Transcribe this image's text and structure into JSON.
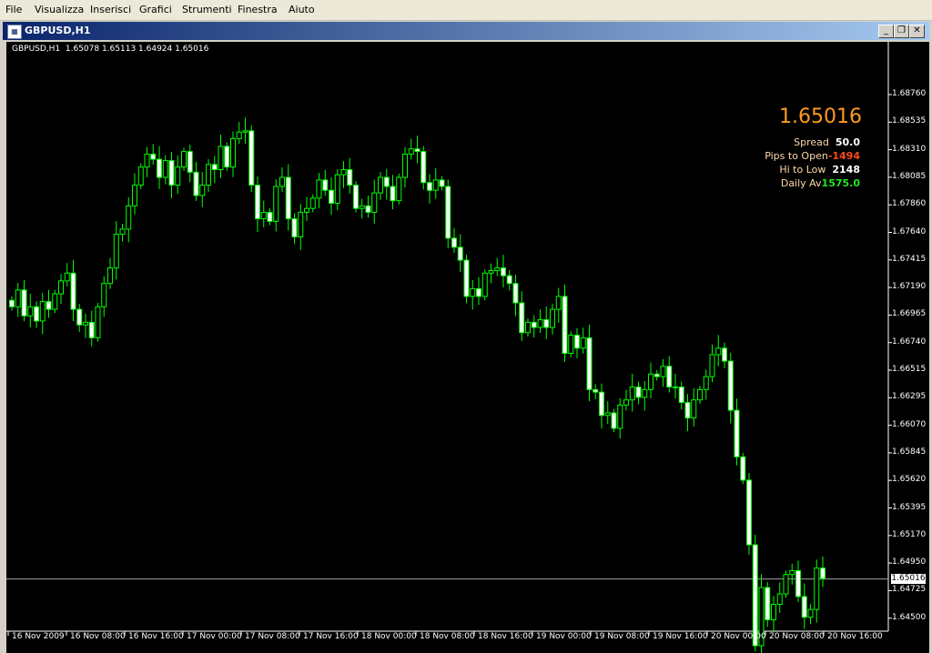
{
  "menu": [
    "File",
    "Visualizza",
    "Inserisci",
    "Grafici",
    "Strumenti",
    "Finestra",
    "Aiuto"
  ],
  "window": {
    "title": "GBPUSD,H1",
    "icon": "chart-window-icon",
    "buttons": [
      "minimize",
      "restore",
      "close"
    ]
  },
  "header": {
    "ohlc": "GBPUSD,H1  1.65078 1.65113 1.64924 1.65016"
  },
  "info_panel": {
    "price": "1.65016",
    "spread_label": "Spread",
    "spread_value": "50.0",
    "pips_label": "Pips to Open",
    "pips_value": "-1494",
    "hilo_label": "Hi to Low",
    "hilo_value": "2148",
    "daily_label": "Daily Av",
    "daily_value": "1575.0",
    "colors": {
      "price": "#ff9a1f",
      "label": "#ffd8a8",
      "spread": "#ffffff",
      "pips": "#ff4a1f",
      "hilo": "#ffffff",
      "daily": "#1fe81f"
    }
  },
  "current_price_tag": "1.65016",
  "y_axis_labels": [
    "1.68760",
    "1.68535",
    "1.68310",
    "1.68085",
    "1.67860",
    "1.67640",
    "1.67415",
    "1.67190",
    "1.66965",
    "1.66740",
    "1.66515",
    "1.66295",
    "1.66070",
    "1.65845",
    "1.65620",
    "1.65395",
    "1.65170",
    "1.64950",
    "1.64725",
    "1.64500"
  ],
  "x_axis_labels": [
    "16 Nov 2009",
    "16 Nov 08:00",
    "16 Nov 16:00",
    "17 Nov 00:00",
    "17 Nov 08:00",
    "17 Nov 16:00",
    "18 Nov 00:00",
    "18 Nov 08:00",
    "18 Nov 16:00",
    "19 Nov 00:00",
    "19 Nov 08:00",
    "19 Nov 16:00",
    "20 Nov 00:00",
    "20 Nov 08:00",
    "20 Nov 16:00"
  ],
  "chart_data": {
    "type": "candlestick",
    "symbol": "GBPUSD",
    "timeframe": "H1",
    "ylim": [
      1.645,
      1.6876
    ],
    "bull_color": "#000000",
    "bear_color": "#ffffff",
    "wick_color": "#00ff00",
    "closes": [
      1.6712,
      1.6725,
      1.6705,
      1.6712,
      1.6701,
      1.6716,
      1.671,
      1.6722,
      1.6732,
      1.6738,
      1.671,
      1.6698,
      1.67,
      1.6688,
      1.6712,
      1.673,
      1.6742,
      1.6768,
      1.6772,
      1.679,
      1.6806,
      1.682,
      1.683,
      1.6826,
      1.6812,
      1.6825,
      1.6806,
      1.682,
      1.6832,
      1.6816,
      1.6798,
      1.6806,
      1.6822,
      1.6818,
      1.6836,
      1.682,
      1.6842,
      1.6847,
      1.6848,
      1.6806,
      1.678,
      1.6785,
      1.6778,
      1.6805,
      1.6812,
      1.678,
      1.6766,
      1.6785,
      1.6788,
      1.6796,
      1.681,
      1.6802,
      1.6792,
      1.6814,
      1.6818,
      1.6806,
      1.6788,
      1.679,
      1.6785,
      1.68,
      1.6812,
      1.6805,
      1.6794,
      1.6812,
      1.683,
      1.6834,
      1.6832,
      1.6808,
      1.6802,
      1.681,
      1.6805,
      1.6765,
      1.6758,
      1.6748,
      1.672,
      1.6726,
      1.672,
      1.6738,
      1.674,
      1.6742,
      1.6736,
      1.673,
      1.6715,
      1.6692,
      1.67,
      1.6696,
      1.6702,
      1.6696,
      1.671,
      1.672,
      1.6676,
      1.669,
      1.668,
      1.6688,
      1.6648,
      1.6646,
      1.6628,
      1.663,
      1.6618,
      1.6636,
      1.664,
      1.665,
      1.6642,
      1.6648,
      1.666,
      1.6658,
      1.6666,
      1.665,
      1.665,
      1.6638,
      1.6626,
      1.664,
      1.6648,
      1.6658,
      1.6675,
      1.668,
      1.667,
      1.6632,
      1.6596,
      1.6578,
      1.6528,
      1.645,
      1.6495,
      1.647,
      1.6482,
      1.649,
      1.6505,
      1.6508,
      1.6488,
      1.6472,
      1.6478,
      1.651,
      1.6502
    ]
  }
}
